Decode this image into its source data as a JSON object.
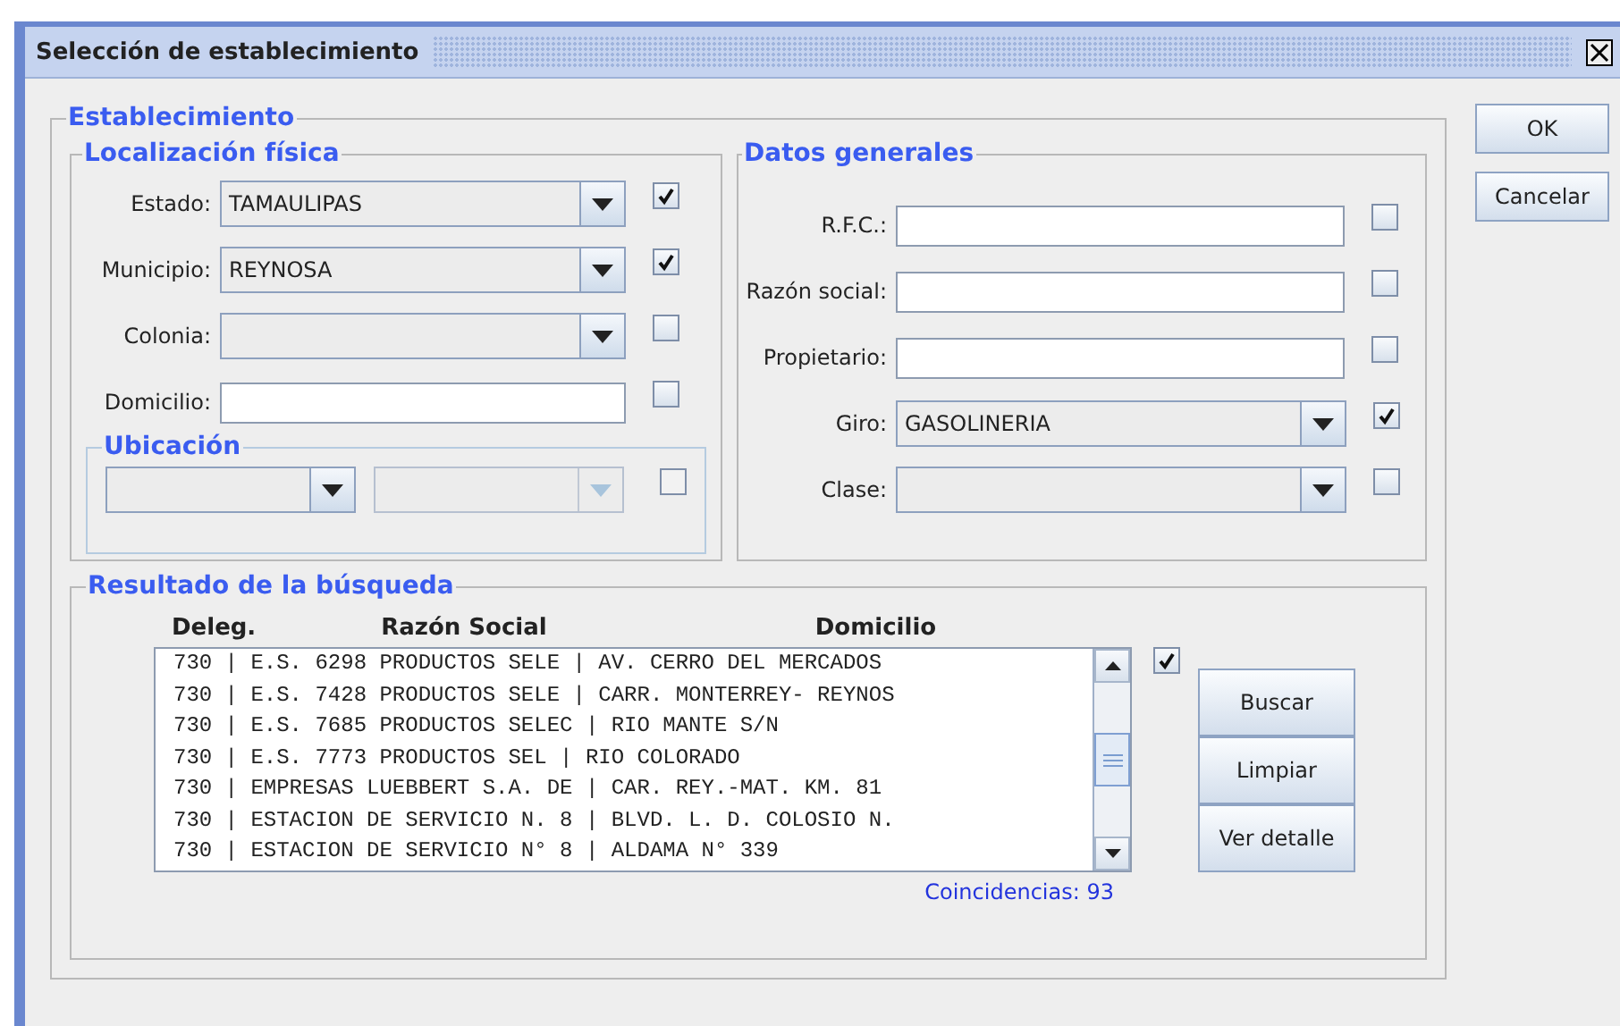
{
  "window": {
    "title": "Selección de establecimiento"
  },
  "group_title": "Establecimiento",
  "location": {
    "title": "Localización física",
    "fields": [
      {
        "kind": "combo",
        "label": "Estado:",
        "value": "TAMAULIPAS",
        "checked": true
      },
      {
        "kind": "combo",
        "label": "Municipio:",
        "value": "REYNOSA",
        "checked": true
      },
      {
        "kind": "combo",
        "label": "Colonia:",
        "checked": false
      },
      {
        "kind": "text",
        "label": "Domicilio:",
        "checked": false
      }
    ],
    "ubicacion": {
      "title": "Ubicación",
      "combos": [
        {
          "disabled": false
        },
        {
          "disabled": true
        }
      ],
      "checked": false
    }
  },
  "general": {
    "title": "Datos generales",
    "fields": [
      {
        "kind": "text",
        "label": "R.F.C.:",
        "checked": false
      },
      {
        "kind": "text",
        "label": "Razón social:",
        "checked": false
      },
      {
        "kind": "text",
        "label": "Propietario:",
        "checked": false
      },
      {
        "kind": "combo",
        "label": "Giro:",
        "value": "GASOLINERIA",
        "checked": true
      },
      {
        "kind": "combo",
        "label": "Clase:",
        "checked": false
      }
    ]
  },
  "results": {
    "title": "Resultado de la búsqueda",
    "columns": [
      "Deleg.",
      "Razón Social",
      "Domicilio"
    ],
    "rows": [
      "730 | E.S. 6298  PRODUCTOS SELE | AV. CERRO DEL MERCADOS",
      "730 | E.S. 7428  PRODUCTOS SELE | CARR. MONTERREY- REYNOS",
      "730 | E.S. 7685 PRODUCTOS SELEC | RIO MANTE S/N",
      "730 | E.S. 7773   PRODUCTOS SEL | RIO COLORADO",
      "730 | EMPRESAS LUEBBERT S.A. DE | CAR. REY.-MAT. KM. 81",
      "730 | ESTACION DE SERVICIO N. 8 | BLVD. L. D. COLOSIO N.",
      "730 | ESTACION DE SERVICIO N° 8 | ALDAMA N° 339"
    ],
    "checked": true,
    "buttons": [
      "Buscar",
      "Limpiar",
      "Ver detalle"
    ],
    "count": "Coincidencias: 93"
  },
  "buttons": [
    "OK",
    "Cancelar"
  ]
}
